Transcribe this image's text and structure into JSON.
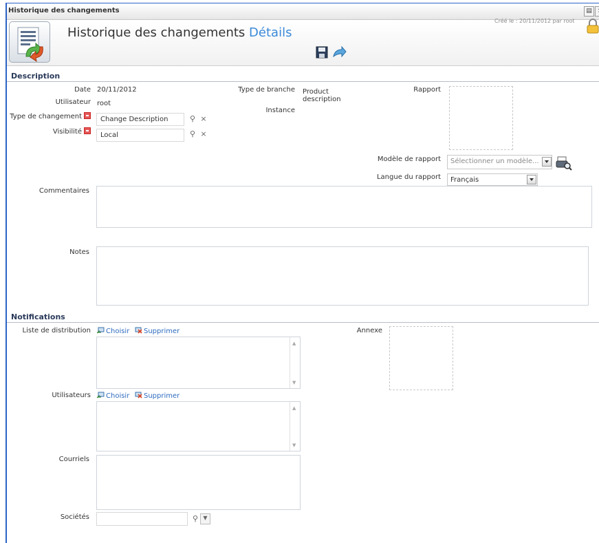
{
  "window": {
    "title": "Historique des changements"
  },
  "header": {
    "title": "Historique des changements",
    "title_accent": "Détails",
    "created": "Créé le : 20/11/2012 par root"
  },
  "description": {
    "heading": "Description",
    "date_label": "Date",
    "date_value": "20/11/2012",
    "user_label": "Utilisateur",
    "user_value": "root",
    "change_type_label": "Type de changement",
    "change_type_value": "Change Description",
    "visibility_label": "Visibilité",
    "visibility_value": "Local",
    "branch_type_label": "Type de branche",
    "branch_type_value_1": "Product",
    "branch_type_value_2": "description",
    "instance_label": "Instance",
    "report_label": "Rapport",
    "report_model_label": "Modèle de rapport",
    "report_model_placeholder": "Sélectionner un modèle...",
    "report_lang_label": "Langue du rapport",
    "report_lang_value": "Français",
    "comments_label": "Commentaires",
    "notes_label": "Notes"
  },
  "notifications": {
    "heading": "Notifications",
    "distribution_label": "Liste de distribution",
    "choose": "Choisir",
    "delete": "Supprimer",
    "attachment_label": "Annexe",
    "users_label": "Utilisateurs",
    "emails_label": "Courriels",
    "companies_label": "Sociétés"
  },
  "colors": {
    "accent": "#3b8ad9",
    "frame": "#2b62c4",
    "link": "#2d6bbf"
  }
}
